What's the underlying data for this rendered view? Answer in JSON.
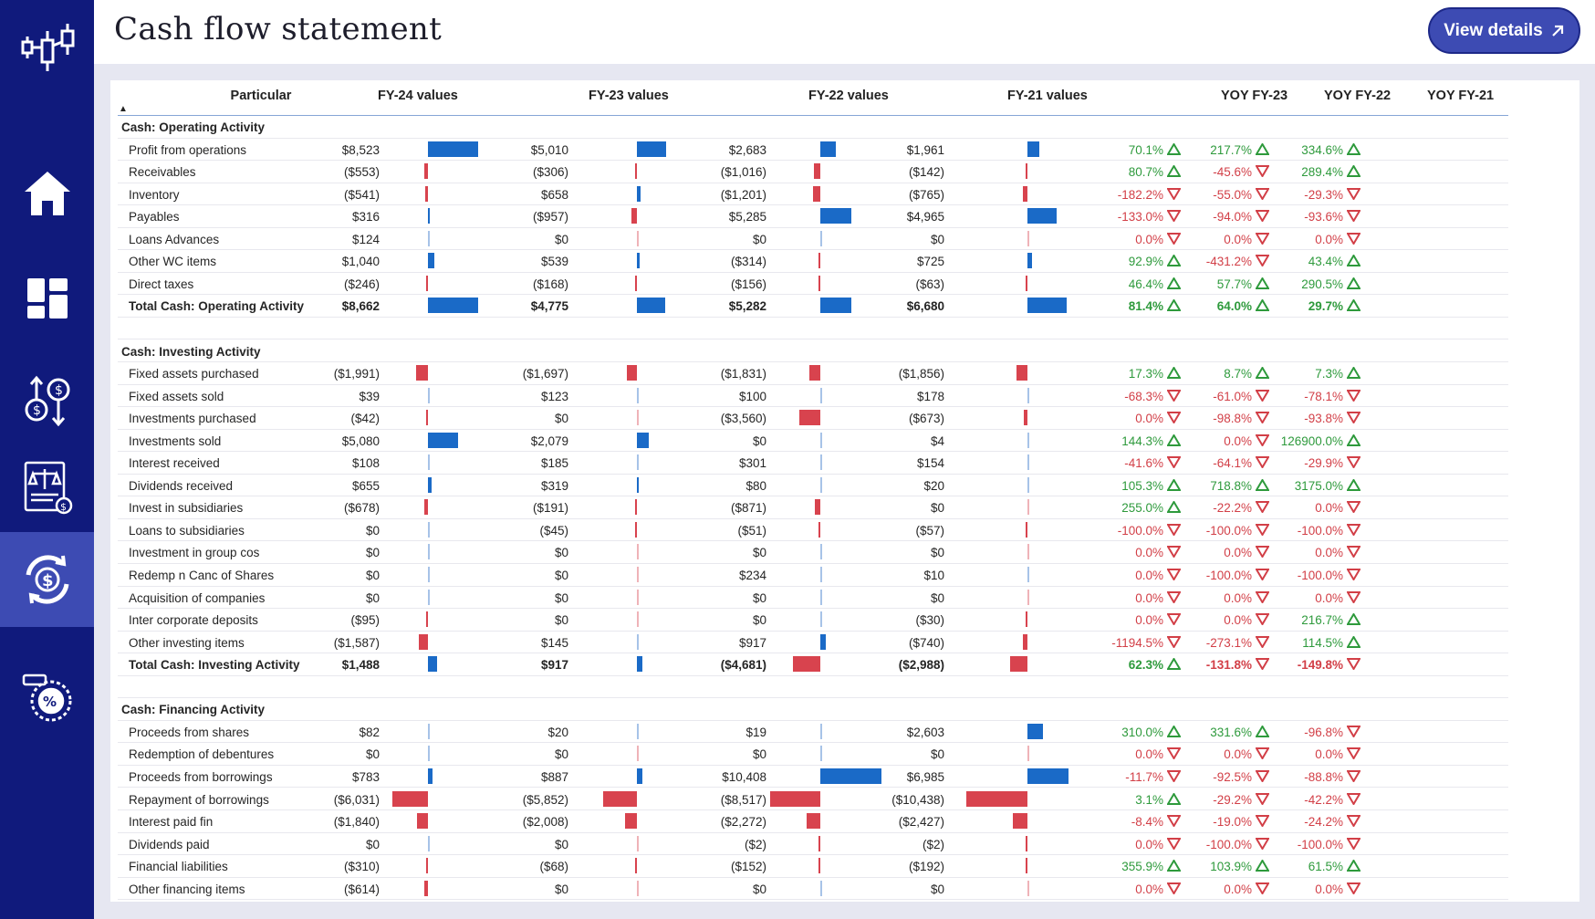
{
  "header": {
    "title": "Cash flow statement",
    "view_details": "View details"
  },
  "nav": [
    {
      "name": "logo-candlestick-icon"
    },
    {
      "name": "home-icon"
    },
    {
      "name": "dashboard-icon"
    },
    {
      "name": "currency-exchange-icon"
    },
    {
      "name": "balance-sheet-icon"
    },
    {
      "name": "cash-flow-icon",
      "active": true
    },
    {
      "name": "ratio-icon"
    }
  ],
  "table": {
    "headers": {
      "particular": "Particular",
      "fy24": "FY-24  values",
      "fy23": "FY-23  values",
      "fy22": "FY-22  values",
      "fy21": "FY-21  values",
      "yoy23": "YOY FY-23",
      "yoy22": "YOY FY-22",
      "yoy21": "YOY FY-21"
    },
    "rows": [
      {
        "type": "section",
        "label": "Cash: Operating Activity"
      },
      {
        "type": "item",
        "label": "Profit from operations",
        "fy24": "$8,523",
        "fy23": "$5,010",
        "fy22": "$2,683",
        "fy21": "$1,961",
        "n": [
          8523,
          5010,
          2683,
          1961
        ],
        "yoy": [
          "70.1%",
          "217.7%",
          "334.6%"
        ],
        "dir": [
          "up",
          "up",
          "up"
        ]
      },
      {
        "type": "item",
        "label": "Receivables",
        "fy24": "($553)",
        "fy23": "($306)",
        "fy22": "($1,016)",
        "fy21": "($142)",
        "n": [
          -553,
          -306,
          -1016,
          -142
        ],
        "yoy": [
          "80.7%",
          "-45.6%",
          "289.4%"
        ],
        "dir": [
          "up",
          "down",
          "up"
        ]
      },
      {
        "type": "item",
        "label": "Inventory",
        "fy24": "($541)",
        "fy23": "$658",
        "fy22": "($1,201)",
        "fy21": "($765)",
        "n": [
          -541,
          658,
          -1201,
          -765
        ],
        "yoy": [
          "-182.2%",
          "-55.0%",
          "-29.3%"
        ],
        "dir": [
          "down",
          "down",
          "down"
        ]
      },
      {
        "type": "item",
        "label": "Payables",
        "fy24": "$316",
        "fy23": "($957)",
        "fy22": "$5,285",
        "fy21": "$4,965",
        "n": [
          316,
          -957,
          5285,
          4965
        ],
        "yoy": [
          "-133.0%",
          "-94.0%",
          "-93.6%"
        ],
        "dir": [
          "down",
          "down",
          "down"
        ]
      },
      {
        "type": "item",
        "label": "Loans Advances",
        "fy24": "$124",
        "fy23": "$0",
        "fy22": "$0",
        "fy21": "$0",
        "n": [
          124,
          0,
          0,
          0
        ],
        "yoy": [
          "0.0%",
          "0.0%",
          "0.0%"
        ],
        "dir": [
          "down",
          "down",
          "down"
        ]
      },
      {
        "type": "item",
        "label": "Other WC items",
        "fy24": "$1,040",
        "fy23": "$539",
        "fy22": "($314)",
        "fy21": "$725",
        "n": [
          1040,
          539,
          -314,
          725
        ],
        "yoy": [
          "92.9%",
          "-431.2%",
          "43.4%"
        ],
        "dir": [
          "up",
          "down",
          "up"
        ]
      },
      {
        "type": "item",
        "label": "Direct taxes",
        "fy24": "($246)",
        "fy23": "($168)",
        "fy22": "($156)",
        "fy21": "($63)",
        "n": [
          -246,
          -168,
          -156,
          -63
        ],
        "yoy": [
          "46.4%",
          "57.7%",
          "290.5%"
        ],
        "dir": [
          "up",
          "up",
          "up"
        ]
      },
      {
        "type": "total",
        "label": "Total Cash: Operating Activity",
        "fy24": "$8,662",
        "fy23": "$4,775",
        "fy22": "$5,282",
        "fy21": "$6,680",
        "n": [
          8662,
          4775,
          5282,
          6680
        ],
        "yoy": [
          "81.4%",
          "64.0%",
          "29.7%"
        ],
        "dir": [
          "up",
          "up",
          "up"
        ]
      },
      {
        "type": "spacer"
      },
      {
        "type": "section",
        "label": "Cash: Investing Activity"
      },
      {
        "type": "item",
        "label": "Fixed assets purchased",
        "fy24": "($1,991)",
        "fy23": "($1,697)",
        "fy22": "($1,831)",
        "fy21": "($1,856)",
        "n": [
          -1991,
          -1697,
          -1831,
          -1856
        ],
        "yoy": [
          "17.3%",
          "8.7%",
          "7.3%"
        ],
        "dir": [
          "up",
          "up",
          "up"
        ]
      },
      {
        "type": "item",
        "label": "Fixed assets sold",
        "fy24": "$39",
        "fy23": "$123",
        "fy22": "$100",
        "fy21": "$178",
        "n": [
          39,
          123,
          100,
          178
        ],
        "yoy": [
          "-68.3%",
          "-61.0%",
          "-78.1%"
        ],
        "dir": [
          "down",
          "down",
          "down"
        ]
      },
      {
        "type": "item",
        "label": "Investments purchased",
        "fy24": "($42)",
        "fy23": "$0",
        "fy22": "($3,560)",
        "fy21": "($673)",
        "n": [
          -42,
          0,
          -3560,
          -673
        ],
        "yoy": [
          "0.0%",
          "-98.8%",
          "-93.8%"
        ],
        "dir": [
          "down",
          "down",
          "down"
        ]
      },
      {
        "type": "item",
        "label": "Investments sold",
        "fy24": "$5,080",
        "fy23": "$2,079",
        "fy22": "$0",
        "fy21": "$4",
        "n": [
          5080,
          2079,
          0,
          4
        ],
        "yoy": [
          "144.3%",
          "0.0%",
          "126900.0%"
        ],
        "dir": [
          "up",
          "down",
          "up"
        ]
      },
      {
        "type": "item",
        "label": "Interest received",
        "fy24": "$108",
        "fy23": "$185",
        "fy22": "$301",
        "fy21": "$154",
        "n": [
          108,
          185,
          301,
          154
        ],
        "yoy": [
          "-41.6%",
          "-64.1%",
          "-29.9%"
        ],
        "dir": [
          "down",
          "down",
          "down"
        ]
      },
      {
        "type": "item",
        "label": "Dividends received",
        "fy24": "$655",
        "fy23": "$319",
        "fy22": "$80",
        "fy21": "$20",
        "n": [
          655,
          319,
          80,
          20
        ],
        "yoy": [
          "105.3%",
          "718.8%",
          "3175.0%"
        ],
        "dir": [
          "up",
          "up",
          "up"
        ]
      },
      {
        "type": "item",
        "label": "Invest in subsidiaries",
        "fy24": "($678)",
        "fy23": "($191)",
        "fy22": "($871)",
        "fy21": "$0",
        "n": [
          -678,
          -191,
          -871,
          0
        ],
        "yoy": [
          "255.0%",
          "-22.2%",
          "0.0%"
        ],
        "dir": [
          "up",
          "down",
          "down"
        ]
      },
      {
        "type": "item",
        "label": "Loans to subsidiaries",
        "fy24": "$0",
        "fy23": "($45)",
        "fy22": "($51)",
        "fy21": "($57)",
        "n": [
          0,
          -45,
          -51,
          -57
        ],
        "yoy": [
          "-100.0%",
          "-100.0%",
          "-100.0%"
        ],
        "dir": [
          "down",
          "down",
          "down"
        ]
      },
      {
        "type": "item",
        "label": "Investment in group cos",
        "fy24": "$0",
        "fy23": "$0",
        "fy22": "$0",
        "fy21": "$0",
        "n": [
          0,
          0,
          0,
          0
        ],
        "yoy": [
          "0.0%",
          "0.0%",
          "0.0%"
        ],
        "dir": [
          "down",
          "down",
          "down"
        ]
      },
      {
        "type": "item",
        "label": "Redemp n Canc of Shares",
        "fy24": "$0",
        "fy23": "$0",
        "fy22": "$234",
        "fy21": "$10",
        "n": [
          0,
          0,
          234,
          10
        ],
        "yoy": [
          "0.0%",
          "-100.0%",
          "-100.0%"
        ],
        "dir": [
          "down",
          "down",
          "down"
        ]
      },
      {
        "type": "item",
        "label": "Acquisition of companies",
        "fy24": "$0",
        "fy23": "$0",
        "fy22": "$0",
        "fy21": "$0",
        "n": [
          0,
          0,
          0,
          0
        ],
        "yoy": [
          "0.0%",
          "0.0%",
          "0.0%"
        ],
        "dir": [
          "down",
          "down",
          "down"
        ]
      },
      {
        "type": "item",
        "label": "Inter corporate deposits",
        "fy24": "($95)",
        "fy23": "$0",
        "fy22": "$0",
        "fy21": "($30)",
        "n": [
          -95,
          0,
          0,
          -30
        ],
        "yoy": [
          "0.0%",
          "0.0%",
          "216.7%"
        ],
        "dir": [
          "down",
          "down",
          "up"
        ]
      },
      {
        "type": "item",
        "label": "Other investing items",
        "fy24": "($1,587)",
        "fy23": "$145",
        "fy22": "$917",
        "fy21": "($740)",
        "n": [
          -1587,
          145,
          917,
          -740
        ],
        "yoy": [
          "-1194.5%",
          "-273.1%",
          "114.5%"
        ],
        "dir": [
          "down",
          "down",
          "up"
        ]
      },
      {
        "type": "total",
        "label": "Total Cash: Investing Activity",
        "fy24": "$1,488",
        "fy23": "$917",
        "fy22": "($4,681)",
        "fy21": "($2,988)",
        "n": [
          1488,
          917,
          -4681,
          -2988
        ],
        "yoy": [
          "62.3%",
          "-131.8%",
          "-149.8%"
        ],
        "dir": [
          "up",
          "down",
          "down"
        ]
      },
      {
        "type": "spacer"
      },
      {
        "type": "section",
        "label": "Cash: Financing Activity"
      },
      {
        "type": "item",
        "label": "Proceeds from shares",
        "fy24": "$82",
        "fy23": "$20",
        "fy22": "$19",
        "fy21": "$2,603",
        "n": [
          82,
          20,
          19,
          2603
        ],
        "yoy": [
          "310.0%",
          "331.6%",
          "-96.8%"
        ],
        "dir": [
          "up",
          "up",
          "down"
        ]
      },
      {
        "type": "item",
        "label": "Redemption of debentures",
        "fy24": "$0",
        "fy23": "$0",
        "fy22": "$0",
        "fy21": "$0",
        "n": [
          0,
          0,
          0,
          0
        ],
        "yoy": [
          "0.0%",
          "0.0%",
          "0.0%"
        ],
        "dir": [
          "down",
          "down",
          "down"
        ]
      },
      {
        "type": "item",
        "label": "Proceeds from borrowings",
        "fy24": "$783",
        "fy23": "$887",
        "fy22": "$10,408",
        "fy21": "$6,985",
        "n": [
          783,
          887,
          10408,
          6985
        ],
        "yoy": [
          "-11.7%",
          "-92.5%",
          "-88.8%"
        ],
        "dir": [
          "down",
          "down",
          "down"
        ]
      },
      {
        "type": "item",
        "label": "Repayment of borrowings",
        "fy24": "($6,031)",
        "fy23": "($5,852)",
        "fy22": "($8,517)",
        "fy21": "($10,438)",
        "n": [
          -6031,
          -5852,
          -8517,
          -10438
        ],
        "yoy": [
          "3.1%",
          "-29.2%",
          "-42.2%"
        ],
        "dir": [
          "up",
          "down",
          "down"
        ]
      },
      {
        "type": "item",
        "label": "Interest paid fin",
        "fy24": "($1,840)",
        "fy23": "($2,008)",
        "fy22": "($2,272)",
        "fy21": "($2,427)",
        "n": [
          -1840,
          -2008,
          -2272,
          -2427
        ],
        "yoy": [
          "-8.4%",
          "-19.0%",
          "-24.2%"
        ],
        "dir": [
          "down",
          "down",
          "down"
        ]
      },
      {
        "type": "item",
        "label": "Dividends paid",
        "fy24": "$0",
        "fy23": "$0",
        "fy22": "($2)",
        "fy21": "($2)",
        "n": [
          0,
          0,
          -2,
          -2
        ],
        "yoy": [
          "0.0%",
          "-100.0%",
          "-100.0%"
        ],
        "dir": [
          "down",
          "down",
          "down"
        ]
      },
      {
        "type": "item",
        "label": "Financial liabilities",
        "fy24": "($310)",
        "fy23": "($68)",
        "fy22": "($152)",
        "fy21": "($192)",
        "n": [
          -310,
          -68,
          -152,
          -192
        ],
        "yoy": [
          "355.9%",
          "103.9%",
          "61.5%"
        ],
        "dir": [
          "up",
          "up",
          "up"
        ]
      },
      {
        "type": "item",
        "label": "Other financing items",
        "fy24": "($614)",
        "fy23": "$0",
        "fy22": "$0",
        "fy21": "$0",
        "n": [
          -614,
          0,
          0,
          0
        ],
        "yoy": [
          "0.0%",
          "0.0%",
          "0.0%"
        ],
        "dir": [
          "down",
          "down",
          "down"
        ]
      }
    ]
  }
}
